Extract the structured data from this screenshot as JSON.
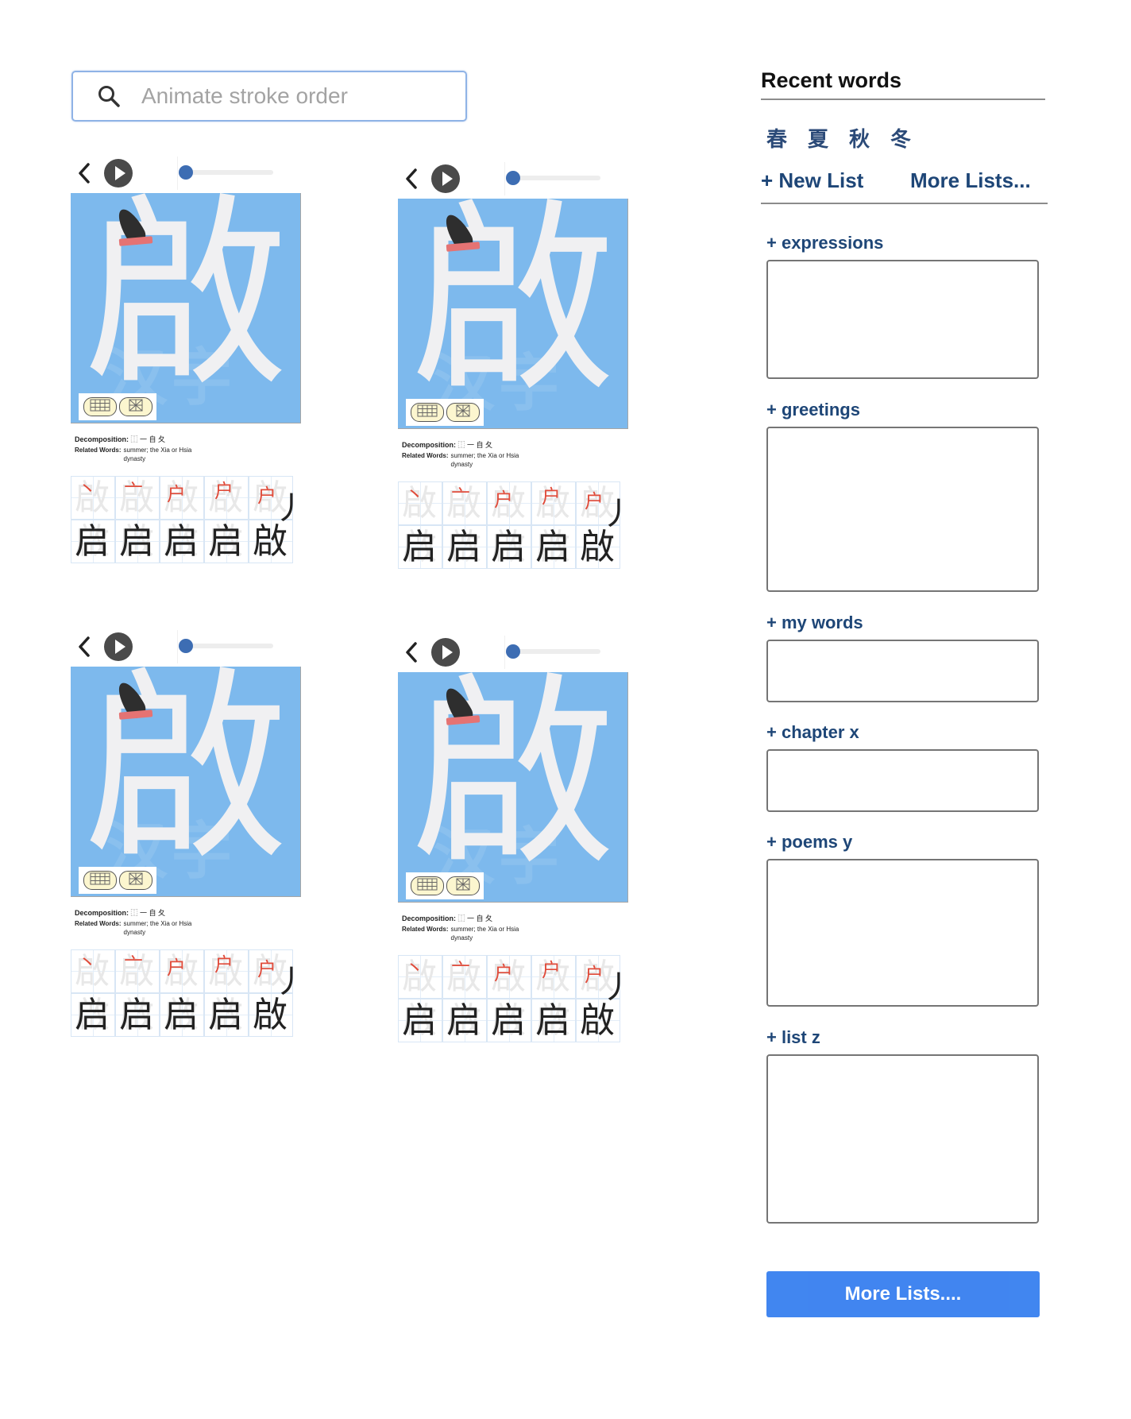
{
  "search": {
    "placeholder": "Animate stroke order",
    "value": ""
  },
  "character": "啟",
  "watermark": "汉字屋",
  "cards": [
    {
      "decomposition_label": "Decomposition:",
      "decomposition_value": "⿰ 一 自 夂",
      "related_label": "Related Words:",
      "related_value": "summer; the Xia or Hsia dynasty",
      "progress": 0.0
    },
    {
      "decomposition_label": "Decomposition:",
      "decomposition_value": "⿰ 一 自 夂",
      "related_label": "Related Words:",
      "related_value": "summer; the Xia or Hsia dynasty",
      "progress": 0.0
    },
    {
      "decomposition_label": "Decomposition:",
      "decomposition_value": "⿰ 一 自 夂",
      "related_label": "Related Words:",
      "related_value": "summer; the Xia or Hsia dynasty",
      "progress": 0.0
    },
    {
      "decomposition_label": "Decomposition:",
      "decomposition_value": "⿰ 一 自 夂",
      "related_label": "Related Words:",
      "related_value": "summer; the Xia or Hsia dynasty",
      "progress": 0.0
    }
  ],
  "stroke_steps": {
    "top_row": [
      "丶",
      "亠",
      "户",
      "户",
      "户"
    ],
    "bottom_row": [
      "启",
      "启",
      "启",
      "启",
      "啟"
    ],
    "overflow": "丿"
  },
  "sidebar": {
    "recent_title": "Recent words",
    "recent_words": [
      "春",
      "夏",
      "秋",
      "冬"
    ],
    "new_list": "+ New List",
    "more_lists_link": "More Lists...",
    "lists": [
      {
        "label": "+ expressions"
      },
      {
        "label": "+ greetings"
      },
      {
        "label": "+ my words"
      },
      {
        "label": "+ chapter x"
      },
      {
        "label": "+ poems y"
      },
      {
        "label": "+ list z"
      }
    ],
    "more_lists_button": "More Lists....",
    "accent_color": "#3b82f0",
    "link_color": "#1e4677"
  },
  "colors": {
    "canvas_bg": "#7db9ed",
    "current_stroke": "#e04b3a",
    "slider": "#3d6db3"
  }
}
